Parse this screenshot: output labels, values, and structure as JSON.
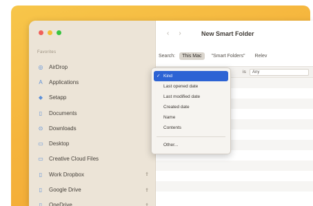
{
  "window": {
    "title": "New Smart Folder",
    "back_glyph": "‹",
    "forward_glyph": "›"
  },
  "sidebar": {
    "section_header": "Favorites",
    "items": [
      {
        "label": "AirDrop",
        "icon": "airdrop-icon",
        "glyph": "◎",
        "cloud": ""
      },
      {
        "label": "Applications",
        "icon": "applications-icon",
        "glyph": "A",
        "cloud": ""
      },
      {
        "label": "Setapp",
        "icon": "setapp-icon",
        "glyph": "◆",
        "cloud": ""
      },
      {
        "label": "Documents",
        "icon": "document-icon",
        "glyph": "▯",
        "cloud": ""
      },
      {
        "label": "Downloads",
        "icon": "downloads-icon",
        "glyph": "⊙",
        "cloud": ""
      },
      {
        "label": "Desktop",
        "icon": "desktop-icon",
        "glyph": "▭",
        "cloud": ""
      },
      {
        "label": "Creative Cloud Files",
        "icon": "folder-icon",
        "glyph": "▭",
        "cloud": ""
      },
      {
        "label": "Work Dropbox",
        "icon": "folder-icon",
        "glyph": "▯",
        "cloud": "⇪"
      },
      {
        "label": "Google Drive",
        "icon": "folder-icon",
        "glyph": "▯",
        "cloud": "⇪"
      },
      {
        "label": "OneDrive",
        "icon": "folder-icon",
        "glyph": "▯",
        "cloud": "⇪"
      }
    ]
  },
  "search": {
    "label": "Search:",
    "scopes": [
      {
        "label": "This Mac",
        "active": true
      },
      {
        "label": "\"Smart Folders\"",
        "active": false
      },
      {
        "label": "Relev",
        "active": false
      }
    ]
  },
  "criteria": {
    "field": "",
    "operator": "is",
    "value": "Any"
  },
  "menu": {
    "items": [
      {
        "label": "Kind",
        "selected": true,
        "check": "✓"
      },
      {
        "label": "Last opened date",
        "selected": false,
        "check": ""
      },
      {
        "label": "Last modified date",
        "selected": false,
        "check": ""
      },
      {
        "label": "Created date",
        "selected": false,
        "check": ""
      },
      {
        "label": "Name",
        "selected": false,
        "check": ""
      },
      {
        "label": "Contents",
        "selected": false,
        "check": ""
      }
    ],
    "other": "Other..."
  },
  "colors": {
    "wallpaper": "#f5b43c",
    "sidebar": "#ece4d7",
    "accent": "#2d63d4"
  }
}
